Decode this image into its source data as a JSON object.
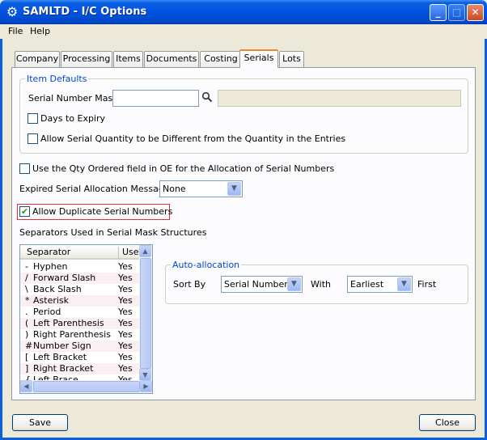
{
  "window": {
    "title": "SAMLTD - I/C Options",
    "icon": "gear-icon"
  },
  "menu": {
    "file": "File",
    "help": "Help"
  },
  "tabs": [
    "Company",
    "Processing",
    "Items",
    "Documents",
    "Costing",
    "Serials",
    "Lots"
  ],
  "active_tab": "Serials",
  "item_defaults": {
    "title": "Item Defaults",
    "mask_label": "Serial Number Mask",
    "mask_value": "",
    "days_to_expiry": "Days to Expiry",
    "allow_serial_qty": "Allow Serial Quantity to be Different from the Quantity in the Entries"
  },
  "use_qty_ordered": "Use the Qty Ordered field in OE for the Allocation of Serial Numbers",
  "expired_msg": {
    "label": "Expired Serial Allocation Message",
    "value": "None"
  },
  "allow_duplicate": {
    "label": "Allow Duplicate Serial Numbers",
    "checked": true
  },
  "separators": {
    "title": "Separators Used in Serial Mask Structures",
    "columns": [
      "Separator",
      "Use"
    ],
    "rows": [
      {
        "sym": "-",
        "name": "Hyphen",
        "use": "Yes"
      },
      {
        "sym": "/",
        "name": "Forward Slash",
        "use": "Yes"
      },
      {
        "sym": "\\",
        "name": "Back Slash",
        "use": "Yes"
      },
      {
        "sym": "*",
        "name": "Asterisk",
        "use": "Yes"
      },
      {
        "sym": ".",
        "name": "Period",
        "use": "Yes"
      },
      {
        "sym": "(",
        "name": "Left Parenthesis",
        "use": "Yes"
      },
      {
        "sym": ")",
        "name": "Right Parenthesis",
        "use": "Yes"
      },
      {
        "sym": "#",
        "name": "Number Sign",
        "use": "Yes"
      },
      {
        "sym": "[",
        "name": "Left Bracket",
        "use": "Yes"
      },
      {
        "sym": "]",
        "name": "Right Bracket",
        "use": "Yes"
      },
      {
        "sym": "{",
        "name": "Left Brace",
        "use": "Yes"
      }
    ]
  },
  "auto_allocation": {
    "title": "Auto-allocation",
    "sort_by_label": "Sort By",
    "sort_by_value": "Serial Number",
    "with_label": "With",
    "with_value": "Earliest",
    "first_label": "First"
  },
  "buttons": {
    "save": "Save",
    "close": "Close"
  }
}
